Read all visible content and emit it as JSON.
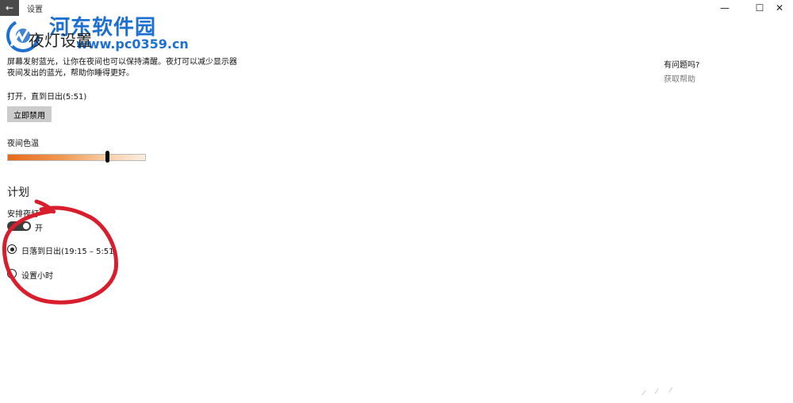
{
  "window": {
    "title": "设置",
    "back_glyph": "←",
    "minimize_glyph": "—",
    "maximize_glyph": "☐",
    "close_glyph": "✕"
  },
  "watermark": {
    "name": "河东软件园",
    "url": "www.pc0359.cn"
  },
  "page": {
    "title": "夜灯设置",
    "description_line1": "屏幕发射蓝光，让你在夜间也可以保持清醒。夜灯可以减少显示器",
    "description_line2": "夜间发出的蓝光，帮助你睡得更好。",
    "status": "打开，直到日出(5:51)",
    "disable_button": "立即禁用",
    "color_temp_label": "夜间色温",
    "color_temp_level": 0.73
  },
  "schedule": {
    "heading": "计划",
    "label": "安排夜灯",
    "toggle_state": "开",
    "toggle_on": true,
    "options": [
      {
        "label": "日落到日出(19:15 – 5:51)",
        "selected": true
      },
      {
        "label": "设置小时",
        "selected": false
      }
    ]
  },
  "help": {
    "question": "有问题吗?",
    "link": "获取帮助"
  },
  "colors": {
    "accent_annotation": "#d81d2c",
    "watermark_blue": "#1d6fd1",
    "slider_warm": "#e86a1c"
  }
}
